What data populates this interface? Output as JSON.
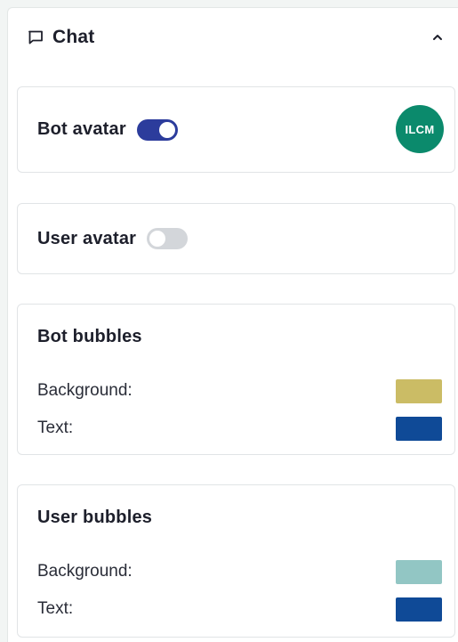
{
  "header": {
    "title": "Chat",
    "icon": "chat-bubble-icon",
    "chevron_icon": "chevron-up-icon"
  },
  "bot_avatar": {
    "label": "Bot avatar",
    "enabled": true,
    "logo_text": "ILCM",
    "logo_color": "#0b8a6c"
  },
  "user_avatar": {
    "label": "User avatar",
    "enabled": false
  },
  "bot_bubbles": {
    "title": "Bot bubbles",
    "background_label": "Background:",
    "background_color": "#cbbc65",
    "text_label": "Text:",
    "text_color": "#0f4a97"
  },
  "user_bubbles": {
    "title": "User bubbles",
    "background_label": "Background:",
    "background_color": "#92c6c4",
    "text_label": "Text:",
    "text_color": "#0f4a97"
  },
  "colors": {
    "toggle_on": "#2c3c9c",
    "toggle_off": "#d3d6da"
  }
}
